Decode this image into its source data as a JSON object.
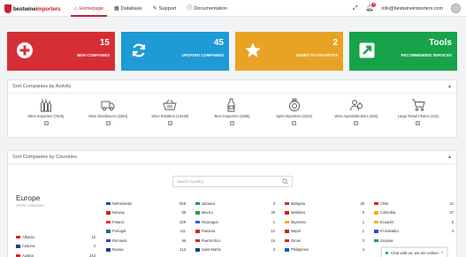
{
  "brand": {
    "logo_main": "bestwine",
    "logo_accent": "importers"
  },
  "nav": [
    {
      "label": "Homepage",
      "icon": "home-icon",
      "active": true
    },
    {
      "label": "Database",
      "icon": "table-icon",
      "active": false
    },
    {
      "label": "Support",
      "icon": "edit-icon",
      "active": false
    },
    {
      "label": "Documentation",
      "icon": "info-icon",
      "active": false
    }
  ],
  "topright": {
    "user_email": "info@bestwineimporters.com",
    "notification_count": "6"
  },
  "cards": [
    {
      "number": "15",
      "label": "New Companies",
      "icon": "plus-icon"
    },
    {
      "number": "45",
      "label": "Updated Companies",
      "icon": "refresh-icon"
    },
    {
      "number": "2",
      "label": "Added to Favorites",
      "icon": "star-icon"
    },
    {
      "number": "Tools",
      "label": "Recommended Services",
      "icon": "external-link-icon"
    }
  ],
  "activity": {
    "title": "Sort Companies by Activity",
    "items": [
      {
        "label": "Wine Importers (7626)"
      },
      {
        "label": "Wine Distributors (3394)"
      },
      {
        "label": "Wine Retailers (10436)"
      },
      {
        "label": "Beer Importers (1085)"
      },
      {
        "label": "Spirit Importers (2224)"
      },
      {
        "label": "Wine Agents/Brokers (250)"
      },
      {
        "label": "Large Retail Chains (131)"
      }
    ]
  },
  "countries": {
    "title": "Sort Companies by Countries",
    "search_placeholder": "Search Country",
    "region": "Europe",
    "region_count": "18046 companies",
    "columns": [
      [
        {
          "name": "Albania",
          "count": "10",
          "flag": "#d22"
        },
        {
          "name": "Andorra",
          "count": "4",
          "flag": "#1e3a8a"
        },
        {
          "name": "Austria",
          "count": "243",
          "flag": "#d22"
        }
      ],
      [
        {
          "name": "Netherlands",
          "count": "928",
          "flag": "#1e4fa0"
        },
        {
          "name": "Norway",
          "count": "88",
          "flag": "#c21"
        },
        {
          "name": "Poland",
          "count": "229",
          "flag": "#e33"
        },
        {
          "name": "Portugal",
          "count": "111",
          "flag": "#176"
        },
        {
          "name": "Romania",
          "count": "96",
          "flag": "#1d4ed8"
        },
        {
          "name": "Russia",
          "count": "112",
          "flag": "#1e3a8a"
        }
      ],
      [
        {
          "name": "Jamaica",
          "count": "3",
          "flag": "#16a34a"
        },
        {
          "name": "Mexico",
          "count": "49",
          "flag": "#16a34a"
        },
        {
          "name": "Nicaragua",
          "count": "1",
          "flag": "#2563eb"
        },
        {
          "name": "Panama",
          "count": "12",
          "flag": "#d22"
        },
        {
          "name": "Puerto Rico",
          "count": "15",
          "flag": "#d22"
        },
        {
          "name": "Saint Martin",
          "count": "3",
          "flag": "#1e3a8a"
        }
      ],
      [
        {
          "name": "Malaysia",
          "count": "28",
          "flag": "#d22"
        },
        {
          "name": "Maldives",
          "count": "5",
          "flag": "#c21"
        },
        {
          "name": "Myanmar",
          "count": "1",
          "flag": "#eab308"
        },
        {
          "name": "Nepal",
          "count": "1",
          "flag": "#c21"
        },
        {
          "name": "Oman",
          "count": "3",
          "flag": "#d22"
        },
        {
          "name": "Philippines",
          "count": "4",
          "flag": "#1d4ed8"
        }
      ],
      [
        {
          "name": "Chile",
          "count": "11",
          "flag": "#d22"
        },
        {
          "name": "Colombia",
          "count": "27",
          "flag": "#eab308"
        },
        {
          "name": "Ecuador",
          "count": "5",
          "flag": "#eab308"
        },
        {
          "name": "El Salvador",
          "count": "4",
          "flag": "#1d4ed8"
        },
        {
          "name": "Guyana",
          "count": "",
          "flag": "#16a34a"
        }
      ]
    ]
  },
  "chat": {
    "label": "Chat with us, we are online!"
  }
}
